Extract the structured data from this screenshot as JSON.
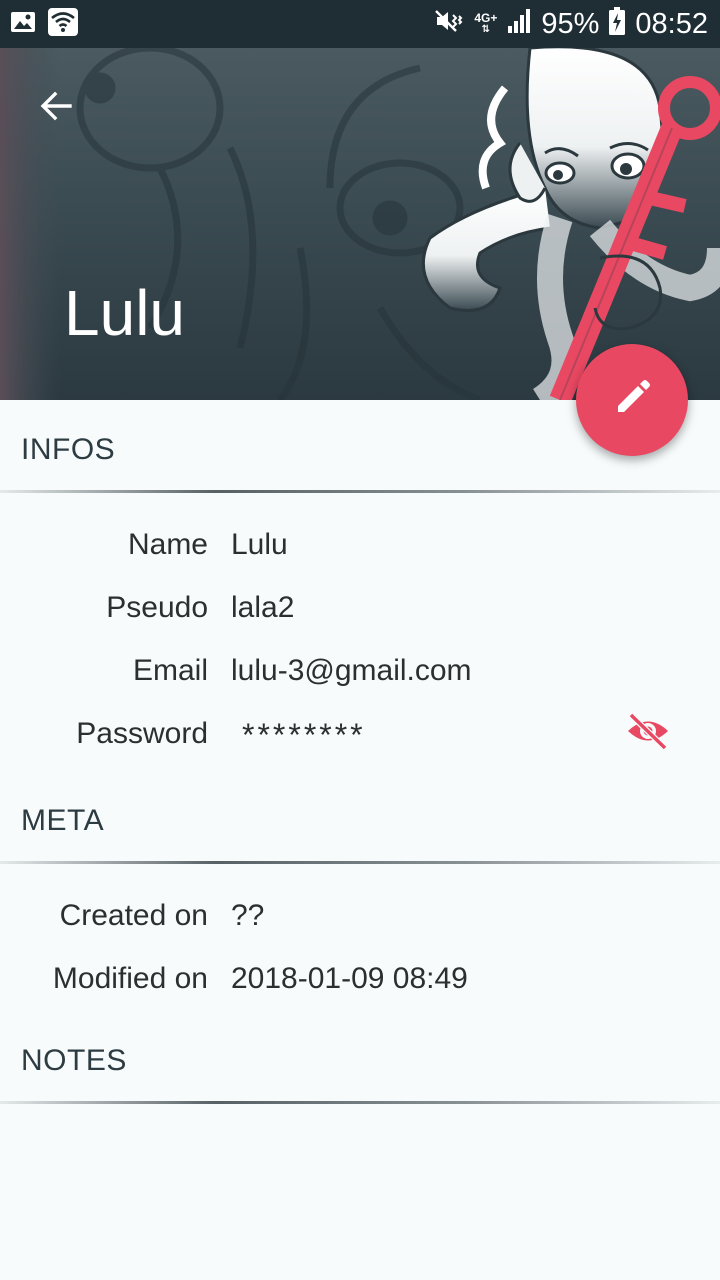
{
  "status_bar": {
    "network": "4G+",
    "battery": "95%",
    "time": "08:52",
    "icons": [
      "image-icon",
      "wifi-icon",
      "mute-vibrate-icon",
      "network-4g-icon",
      "signal-icon",
      "battery-charging-icon"
    ]
  },
  "header": {
    "title": "Lulu",
    "back_icon": "arrow-back-icon"
  },
  "fab": {
    "icon": "pencil-icon"
  },
  "sections": {
    "infos": {
      "title": "INFOS",
      "rows": [
        {
          "label": "Name",
          "value": "Lulu"
        },
        {
          "label": "Pseudo",
          "value": "lala2"
        },
        {
          "label": "Email",
          "value": "lulu-3@gmail.com"
        },
        {
          "label": "Password",
          "value": "********"
        }
      ],
      "toggle_icon": "eye-off-icon"
    },
    "meta": {
      "title": "META",
      "rows": [
        {
          "label": "Created on",
          "value": "??"
        },
        {
          "label": "Modified on",
          "value": "2018-01-09 08:49"
        }
      ]
    },
    "notes": {
      "title": "NOTES"
    }
  },
  "colors": {
    "accent": "#e94862",
    "status_bar": "#1f2e35",
    "header_dark": "#2b3940",
    "background": "#f7fbfb"
  }
}
